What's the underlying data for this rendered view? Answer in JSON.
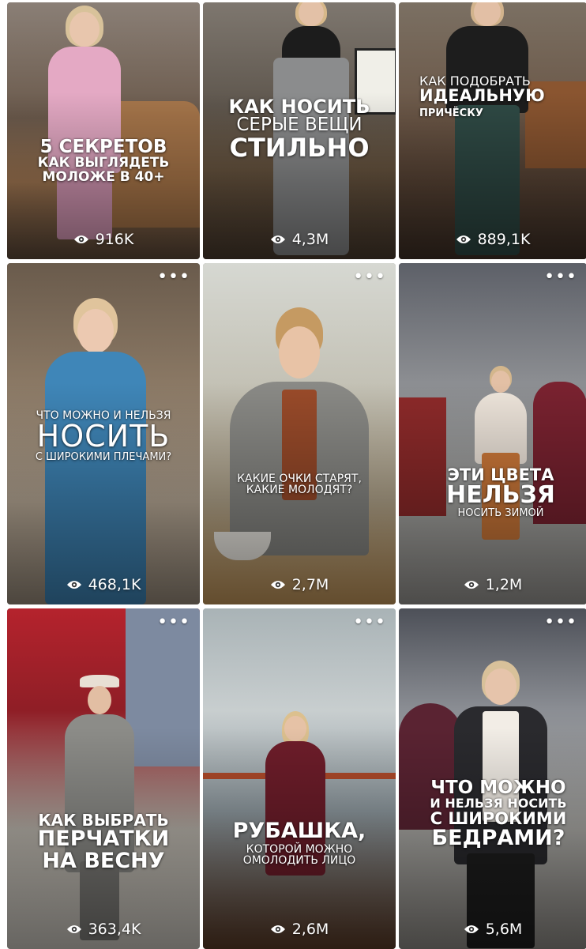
{
  "tiles": [
    {
      "lines": [
        "5 СЕКРЕТОВ",
        "КАК ВЫГЛЯДЕТЬ",
        "МОЛОЖЕ В 40+"
      ],
      "views": "916K"
    },
    {
      "lines": [
        "КАК НОСИТЬ",
        "СЕРЫЕ ВЕЩИ",
        "СТИЛЬНО"
      ],
      "views": "4,3M"
    },
    {
      "lines": [
        "КАК ПОДОБРАТЬ",
        "ИДЕАЛЬНУЮ",
        "ПРИЧЁСКУ"
      ],
      "views": "889,1K"
    },
    {
      "lines": [
        "ЧТО МОЖНО И НЕЛЬЗЯ",
        "НОСИТЬ",
        "С ШИРОКИМИ ПЛЕЧАМИ?"
      ],
      "views": "468,1K"
    },
    {
      "lines": [
        "КАКИЕ ОЧКИ СТАРЯТ,",
        "КАКИЕ МОЛОДЯТ?"
      ],
      "views": "2,7M"
    },
    {
      "lines": [
        "ЭТИ ЦВЕТА",
        "НЕЛЬЗЯ",
        "НОСИТЬ ЗИМОЙ"
      ],
      "views": "1,2M"
    },
    {
      "lines": [
        "КАК ВЫБРАТЬ",
        "ПЕРЧАТКИ",
        "НА ВЕСНУ"
      ],
      "views": "363,4K"
    },
    {
      "lines": [
        "РУБАШКА,",
        "КОТОРОЙ МОЖНО",
        "ОМОЛОДИТЬ ЛИЦО"
      ],
      "views": "2,6M"
    },
    {
      "lines": [
        "ЧТО МОЖНО",
        "И НЕЛЬЗЯ НОСИТЬ",
        "С ШИРОКИМИ",
        "БЕДРАМИ?"
      ],
      "views": "5,6M"
    }
  ],
  "more_glyph": "•••",
  "icons": {
    "views": "eye-icon",
    "more": "more-dots-icon"
  },
  "colors": {
    "caption_text": "#ffffff",
    "page_bg": "#ffffff"
  }
}
